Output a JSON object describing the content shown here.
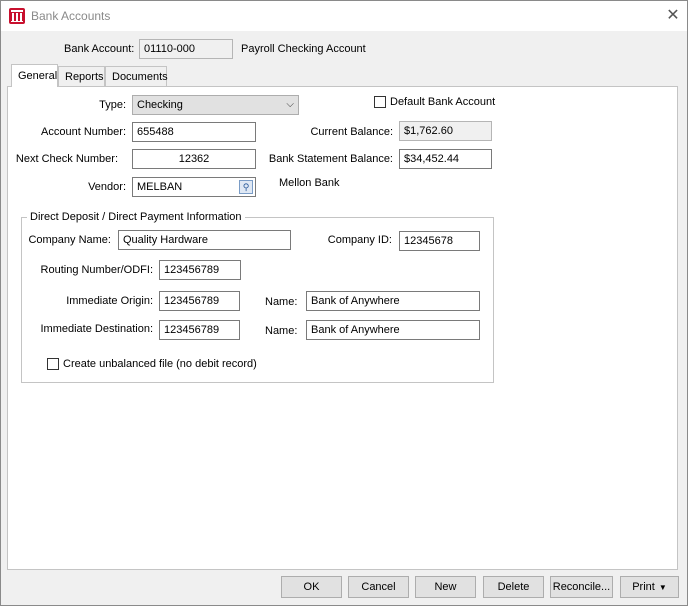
{
  "window": {
    "title": "Bank Accounts",
    "close_glyph": "✕"
  },
  "header": {
    "bank_account_label": "Bank Account:",
    "bank_account_value": "01110-000",
    "account_description": "Payroll Checking Account"
  },
  "tabs": [
    {
      "label": "General",
      "active": true
    },
    {
      "label": "Reports"
    },
    {
      "label": "Documents"
    }
  ],
  "general": {
    "type_label": "Type:",
    "type_value": "Checking",
    "default_bank_label": "Default Bank Account",
    "default_bank_checked": false,
    "account_number_label": "Account Number:",
    "account_number_value": "655488",
    "current_balance_label": "Current Balance:",
    "current_balance_value": "$1,762.60",
    "next_check_label": "Next Check Number:",
    "next_check_value": "12362",
    "bank_statement_label": "Bank Statement Balance:",
    "bank_statement_value": "$34,452.44",
    "vendor_label": "Vendor:",
    "vendor_value": "MELBAN",
    "vendor_name": "Mellon Bank"
  },
  "direct_deposit": {
    "title": "Direct Deposit / Direct Payment Information",
    "company_name_label": "Company Name:",
    "company_name_value": "Quality Hardware",
    "company_id_label": "Company ID:",
    "company_id_value": "12345678",
    "routing_label": "Routing Number/ODFI:",
    "routing_value": "123456789",
    "immediate_origin_label": "Immediate Origin:",
    "immediate_origin_value": "123456789",
    "origin_name_label": "Name:",
    "origin_name_value": "Bank of Anywhere",
    "immediate_destination_label": "Immediate Destination:",
    "immediate_destination_value": "123456789",
    "destination_name_label": "Name:",
    "destination_name_value": "Bank of Anywhere",
    "unbalanced_label": "Create unbalanced file (no debit record)",
    "unbalanced_checked": false
  },
  "buttons": {
    "ok": "OK",
    "cancel": "Cancel",
    "new": "New",
    "delete": "Delete",
    "reconcile": "Reconcile...",
    "print": "Print"
  },
  "icons": {
    "app": "bank-icon",
    "lookup": "magnifier-icon",
    "dropdown": "chevron-down-icon"
  },
  "colors": {
    "brand": "#c8102e"
  }
}
